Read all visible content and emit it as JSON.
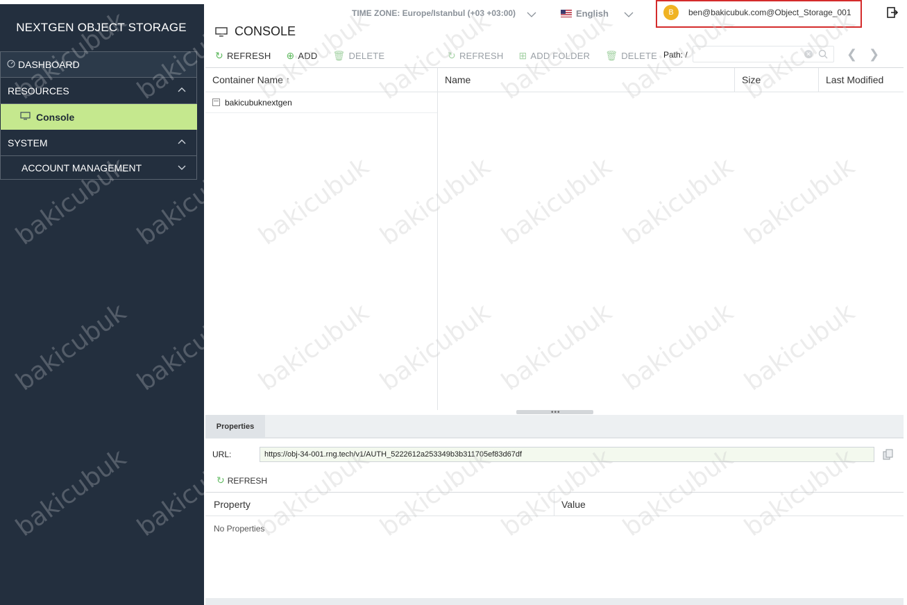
{
  "brand": "NEXTGEN OBJECT STORAGE",
  "sidebar": {
    "items": [
      {
        "label": "DASHBOARD",
        "icon": "dashboard-icon"
      },
      {
        "label": "RESOURCES",
        "icon": "chevron-up-icon"
      },
      {
        "label": "Console",
        "icon": "monitor-icon",
        "active": true
      },
      {
        "label": "SYSTEM",
        "icon": "chevron-up-icon"
      },
      {
        "label": "ACCOUNT MANAGEMENT",
        "icon": "chevron-down-icon"
      }
    ]
  },
  "header": {
    "timezone": "TIME ZONE: Europe/Istanbul (+03 +03:00)",
    "language": "English",
    "user_initial": "B",
    "user": "ben@bakicubuk.com@Object_Storage_001",
    "page_title": "CONSOLE"
  },
  "containers_toolbar": {
    "refresh": "REFRESH",
    "add": "ADD",
    "delete": "DELETE"
  },
  "objects_toolbar": {
    "refresh": "REFRESH",
    "add_folder": "ADD FOLDER",
    "delete": "DELETE",
    "path_label": "Path: /",
    "path_value": ""
  },
  "containers_table": {
    "header": "Container Name",
    "rows": [
      "bakicubuknextgen"
    ]
  },
  "objects_table": {
    "headers": [
      "Name",
      "Size",
      "Last Modified"
    ]
  },
  "properties": {
    "tab": "Properties",
    "url_label": "URL:",
    "url": "https://obj-34-001.rng.tech/v1/AUTH_5222612a253349b3b311705ef83d67df",
    "refresh": "REFRESH",
    "headers": [
      "Property",
      "Value"
    ],
    "empty": "No Properties"
  },
  "watermark": "bakicubuk",
  "colors": {
    "sidebar_bg": "#232f3e",
    "active_item": "#c5e88e",
    "accent_green": "#5cb85c",
    "user_box_border": "#d42b2b",
    "avatar": "#f0b323"
  }
}
